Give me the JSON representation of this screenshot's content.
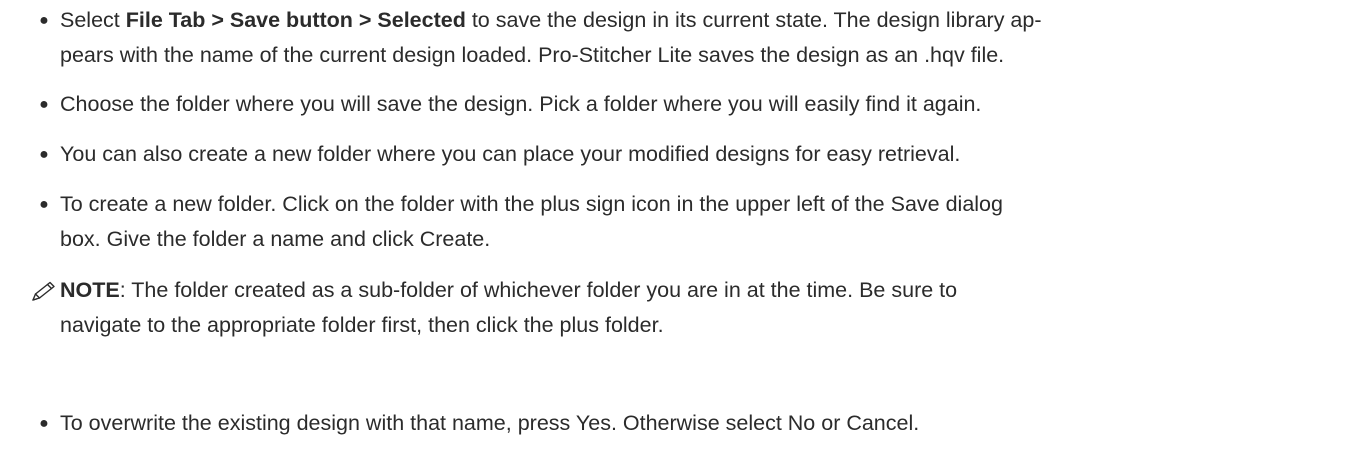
{
  "bullets": [
    {
      "bold": "File Tab > Save button > Selected",
      "prefix": "Select ",
      "suffix": " to save the design in its current state. The design library ap-",
      "line2": "pears with the name of the current design loaded. Pro-Stitcher Lite saves the design as an .hqv file."
    },
    {
      "text": "Choose the folder where you will save the design. Pick a folder where you will easily find it again."
    },
    {
      "text": "You can also create a new folder where you can place your modified designs for easy retrieval."
    },
    {
      "line1": "To create a new folder. Click on the folder with the plus sign icon in the upper left of the Save dialog",
      "line2": "box. Give the folder a name and click Create."
    }
  ],
  "note": {
    "label": "NOTE",
    "line1": ": The folder created as a sub-folder of whichever folder you are in at the time. Be sure to",
    "line2": "navigate to the appropriate folder first, then click the plus folder."
  },
  "last_bullet": {
    "text": "To overwrite the existing design with that name, press Yes. Otherwise select No or Cancel."
  },
  "bullet_char": "●",
  "icons": {
    "note": "pencil-icon"
  },
  "colors": {
    "text": "#2b2b2b",
    "background": "#ffffff"
  }
}
